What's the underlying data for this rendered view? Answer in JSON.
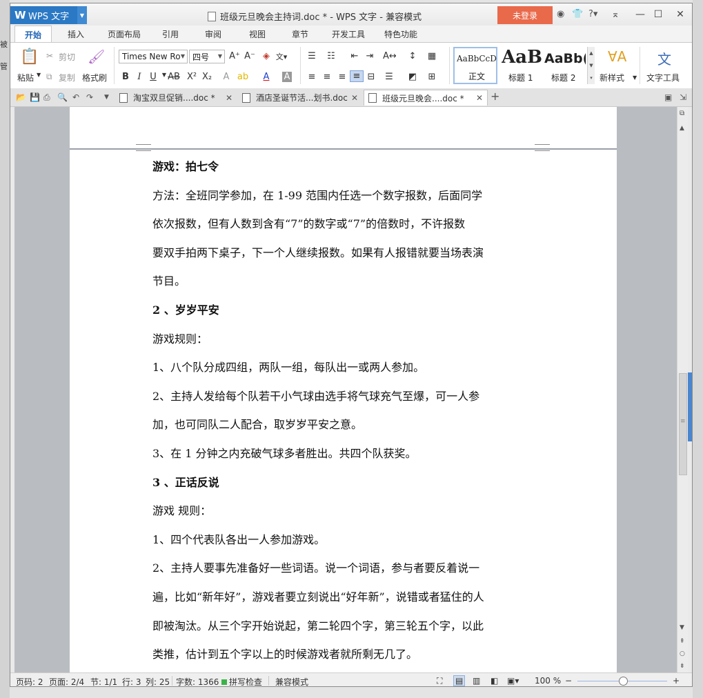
{
  "app": {
    "name": "WPS 文字",
    "window_title": "班级元旦晚会主持词.doc * - WPS 文字 - 兼容模式",
    "login_label": "未登录"
  },
  "ribbon_tabs": [
    "开始",
    "插入",
    "页面布局",
    "引用",
    "审阅",
    "视图",
    "章节",
    "开发工具",
    "特色功能"
  ],
  "ribbon": {
    "paste": "粘贴",
    "cut": "剪切",
    "copy": "复制",
    "format_painter": "格式刷",
    "font_name": "Times New Ro",
    "font_size": "四号",
    "styles": [
      {
        "preview": "AaBbCcD",
        "label": "正文"
      },
      {
        "preview": "AaB",
        "label": "标题 1"
      },
      {
        "preview": "AaBb(",
        "label": "标题 2"
      }
    ],
    "new_style": "新样式",
    "text_tools": "文字工具"
  },
  "doc_tabs": [
    {
      "label": "淘宝双旦促销....doc *",
      "active": false
    },
    {
      "label": "酒店圣诞节活...划书.doc",
      "active": false
    },
    {
      "label": "班级元旦晚会....doc *",
      "active": true
    }
  ],
  "content": [
    {
      "text": "游戏：拍七令",
      "bold": true
    },
    {
      "text": "方法：全班同学参加，在 1-99 范围内任选一个数字报数，后面同学",
      "bold": false
    },
    {
      "text": "依次报数，但有人数到含有“7”的数字或“7”的倍数时，不许报数",
      "bold": false
    },
    {
      "text": "要双手拍两下桌子，下一个人继续报数。如果有人报错就要当场表演",
      "bold": false
    },
    {
      "text": "节目。",
      "bold": false
    },
    {
      "text": "2 、岁岁平安",
      "bold": true
    },
    {
      "text": "游戏规则：",
      "bold": false
    },
    {
      "text": "1、八个队分成四组，两队一组，每队出一或两人参加。",
      "bold": false
    },
    {
      "text": "2、主持人发给每个队若干小气球由选手将气球充气至爆，可一人参",
      "bold": false
    },
    {
      "text": "加，也可同队二人配合，取岁岁平安之意。",
      "bold": false
    },
    {
      "text": "3、在 1 分钟之内充破气球多者胜出。共四个队获奖。",
      "bold": false
    },
    {
      "text": "3 、正话反说",
      "bold": true
    },
    {
      "text": "游戏 规则：",
      "bold": false
    },
    {
      "text": "1、四个代表队各出一人参加游戏。",
      "bold": false
    },
    {
      "text": "2、主持人要事先准备好一些词语。说一个词语，参与者要反着说一",
      "bold": false
    },
    {
      "text": "遍，比如“新年好”，游戏者要立刻说出“好年新”，说错或者猛住的人",
      "bold": false
    },
    {
      "text": "即被淘汰。从三个字开始说起，第二轮四个字，第三轮五个字，以此",
      "bold": false
    },
    {
      "text": "类推，估计到五个字以上的时候游戏者就所剩无几了。",
      "bold": false
    }
  ],
  "status": {
    "page_num": "页码: 2",
    "pages": "页面: 2/4",
    "section": "节: 1/1",
    "row": "行: 3",
    "col": "列: 25",
    "word_count": "字数: 1366",
    "spell_check": "拼写检查",
    "compat_mode": "兼容模式",
    "zoom": "100 %"
  },
  "background_left": [
    "被",
    "管"
  ],
  "colors": {
    "app_blue": "#2b79c4",
    "login_orange": "#e9694b",
    "tab_active_text": "#1e63b6",
    "work_bg": "#b9bcc1"
  }
}
